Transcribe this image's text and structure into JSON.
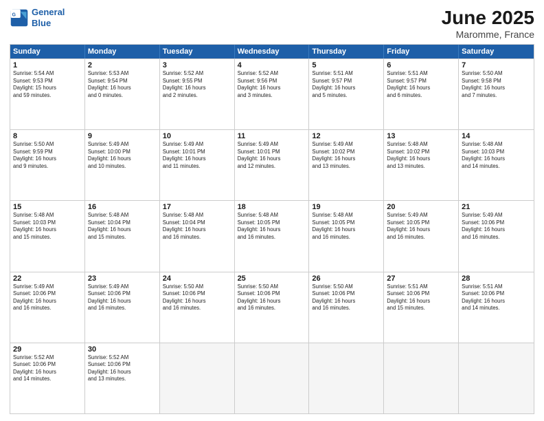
{
  "logo": {
    "line1": "General",
    "line2": "Blue"
  },
  "title": "June 2025",
  "subtitle": "Maromme, France",
  "days": [
    "Sunday",
    "Monday",
    "Tuesday",
    "Wednesday",
    "Thursday",
    "Friday",
    "Saturday"
  ],
  "rows": [
    [
      {
        "day": "1",
        "info": "Sunrise: 5:54 AM\nSunset: 9:53 PM\nDaylight: 15 hours\nand 59 minutes."
      },
      {
        "day": "2",
        "info": "Sunrise: 5:53 AM\nSunset: 9:54 PM\nDaylight: 16 hours\nand 0 minutes."
      },
      {
        "day": "3",
        "info": "Sunrise: 5:52 AM\nSunset: 9:55 PM\nDaylight: 16 hours\nand 2 minutes."
      },
      {
        "day": "4",
        "info": "Sunrise: 5:52 AM\nSunset: 9:56 PM\nDaylight: 16 hours\nand 3 minutes."
      },
      {
        "day": "5",
        "info": "Sunrise: 5:51 AM\nSunset: 9:57 PM\nDaylight: 16 hours\nand 5 minutes."
      },
      {
        "day": "6",
        "info": "Sunrise: 5:51 AM\nSunset: 9:57 PM\nDaylight: 16 hours\nand 6 minutes."
      },
      {
        "day": "7",
        "info": "Sunrise: 5:50 AM\nSunset: 9:58 PM\nDaylight: 16 hours\nand 7 minutes."
      }
    ],
    [
      {
        "day": "8",
        "info": "Sunrise: 5:50 AM\nSunset: 9:59 PM\nDaylight: 16 hours\nand 9 minutes."
      },
      {
        "day": "9",
        "info": "Sunrise: 5:49 AM\nSunset: 10:00 PM\nDaylight: 16 hours\nand 10 minutes."
      },
      {
        "day": "10",
        "info": "Sunrise: 5:49 AM\nSunset: 10:01 PM\nDaylight: 16 hours\nand 11 minutes."
      },
      {
        "day": "11",
        "info": "Sunrise: 5:49 AM\nSunset: 10:01 PM\nDaylight: 16 hours\nand 12 minutes."
      },
      {
        "day": "12",
        "info": "Sunrise: 5:49 AM\nSunset: 10:02 PM\nDaylight: 16 hours\nand 13 minutes."
      },
      {
        "day": "13",
        "info": "Sunrise: 5:48 AM\nSunset: 10:02 PM\nDaylight: 16 hours\nand 13 minutes."
      },
      {
        "day": "14",
        "info": "Sunrise: 5:48 AM\nSunset: 10:03 PM\nDaylight: 16 hours\nand 14 minutes."
      }
    ],
    [
      {
        "day": "15",
        "info": "Sunrise: 5:48 AM\nSunset: 10:03 PM\nDaylight: 16 hours\nand 15 minutes."
      },
      {
        "day": "16",
        "info": "Sunrise: 5:48 AM\nSunset: 10:04 PM\nDaylight: 16 hours\nand 15 minutes."
      },
      {
        "day": "17",
        "info": "Sunrise: 5:48 AM\nSunset: 10:04 PM\nDaylight: 16 hours\nand 16 minutes."
      },
      {
        "day": "18",
        "info": "Sunrise: 5:48 AM\nSunset: 10:05 PM\nDaylight: 16 hours\nand 16 minutes."
      },
      {
        "day": "19",
        "info": "Sunrise: 5:48 AM\nSunset: 10:05 PM\nDaylight: 16 hours\nand 16 minutes."
      },
      {
        "day": "20",
        "info": "Sunrise: 5:49 AM\nSunset: 10:05 PM\nDaylight: 16 hours\nand 16 minutes."
      },
      {
        "day": "21",
        "info": "Sunrise: 5:49 AM\nSunset: 10:06 PM\nDaylight: 16 hours\nand 16 minutes."
      }
    ],
    [
      {
        "day": "22",
        "info": "Sunrise: 5:49 AM\nSunset: 10:06 PM\nDaylight: 16 hours\nand 16 minutes."
      },
      {
        "day": "23",
        "info": "Sunrise: 5:49 AM\nSunset: 10:06 PM\nDaylight: 16 hours\nand 16 minutes."
      },
      {
        "day": "24",
        "info": "Sunrise: 5:50 AM\nSunset: 10:06 PM\nDaylight: 16 hours\nand 16 minutes."
      },
      {
        "day": "25",
        "info": "Sunrise: 5:50 AM\nSunset: 10:06 PM\nDaylight: 16 hours\nand 16 minutes."
      },
      {
        "day": "26",
        "info": "Sunrise: 5:50 AM\nSunset: 10:06 PM\nDaylight: 16 hours\nand 16 minutes."
      },
      {
        "day": "27",
        "info": "Sunrise: 5:51 AM\nSunset: 10:06 PM\nDaylight: 16 hours\nand 15 minutes."
      },
      {
        "day": "28",
        "info": "Sunrise: 5:51 AM\nSunset: 10:06 PM\nDaylight: 16 hours\nand 14 minutes."
      }
    ],
    [
      {
        "day": "29",
        "info": "Sunrise: 5:52 AM\nSunset: 10:06 PM\nDaylight: 16 hours\nand 14 minutes."
      },
      {
        "day": "30",
        "info": "Sunrise: 5:52 AM\nSunset: 10:06 PM\nDaylight: 16 hours\nand 13 minutes."
      },
      {
        "day": "",
        "info": ""
      },
      {
        "day": "",
        "info": ""
      },
      {
        "day": "",
        "info": ""
      },
      {
        "day": "",
        "info": ""
      },
      {
        "day": "",
        "info": ""
      }
    ]
  ]
}
